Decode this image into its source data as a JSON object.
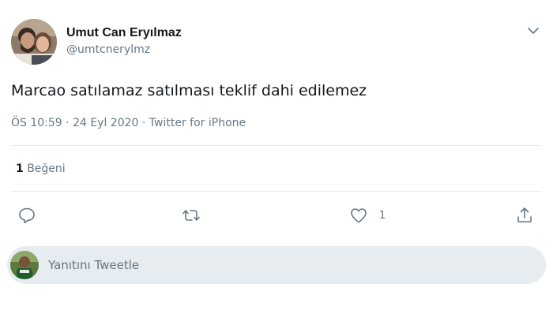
{
  "author": {
    "display_name": "Umut Can Eryılmaz",
    "handle": "@umtcnerylmz"
  },
  "tweet": {
    "text": "Marcao satılamaz satılması teklif dahi edilemez",
    "time": "ÖS 10:59",
    "date": "24 Eyl 2020",
    "source": "Twitter for iPhone",
    "separator": " · "
  },
  "stats": {
    "like_count": "1",
    "like_label": "Beğeni"
  },
  "actions": {
    "reply_icon": "reply-icon",
    "retweet_icon": "retweet-icon",
    "like_icon": "heart-icon",
    "like_count": "1",
    "share_icon": "share-icon"
  },
  "reply_box": {
    "placeholder": "Yanıtını Tweetle"
  },
  "colors": {
    "text_primary": "#14171a",
    "text_secondary": "#657786",
    "divider": "#e6ecf0",
    "reply_box_bg": "#e6ecf0"
  }
}
